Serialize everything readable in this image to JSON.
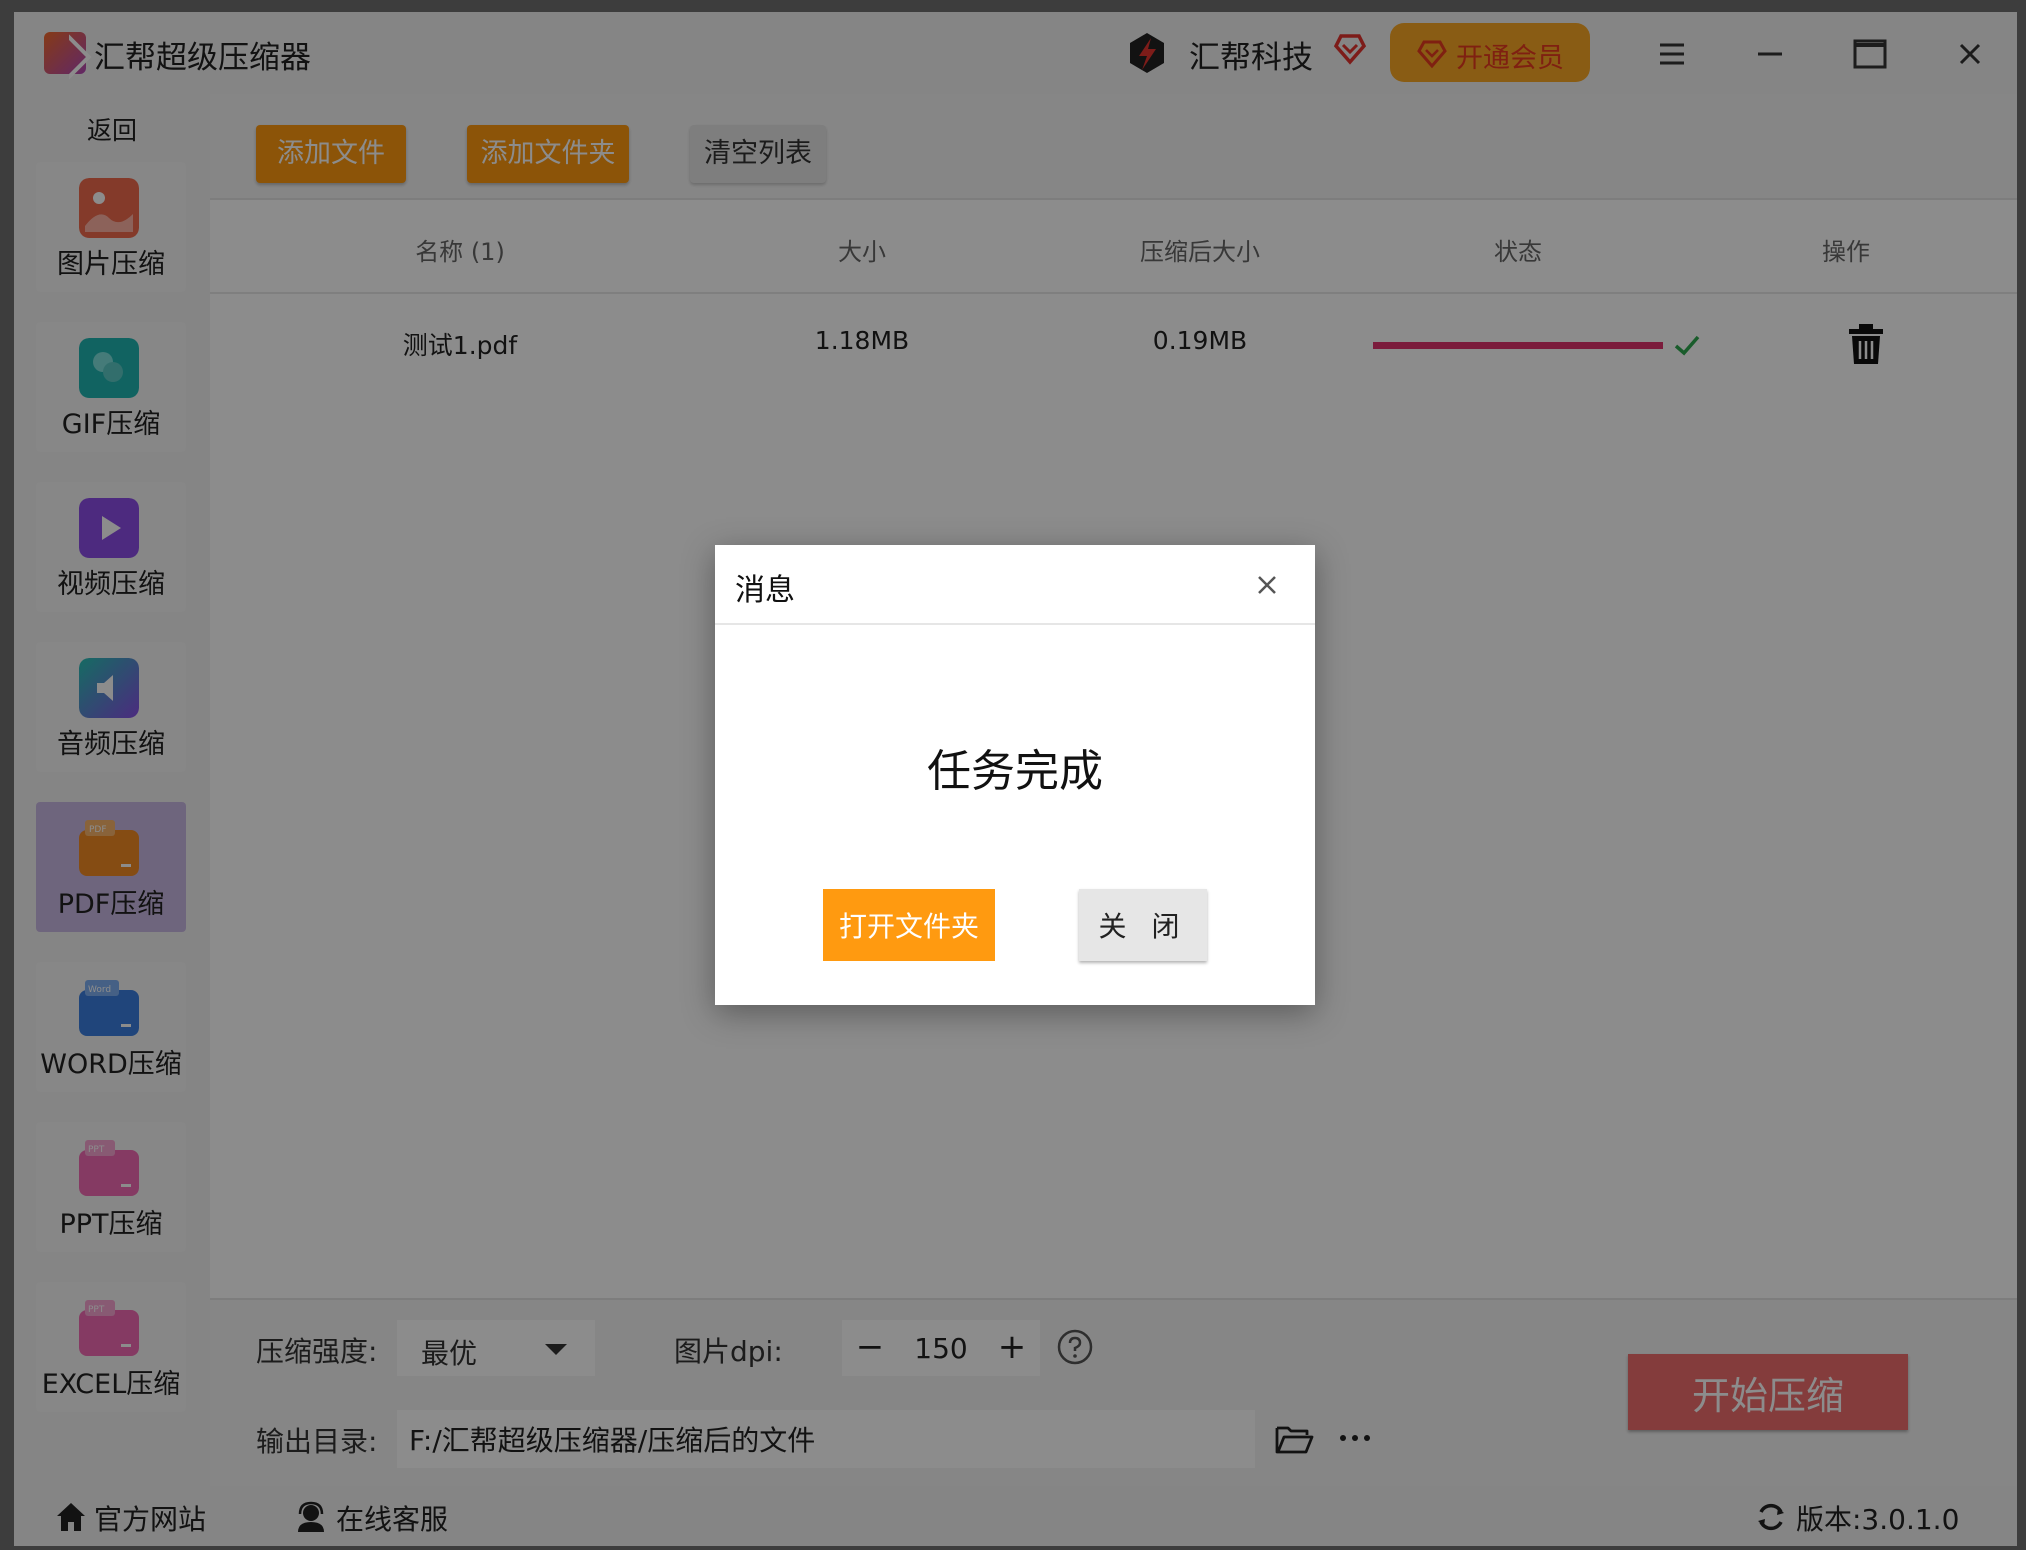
{
  "app": {
    "title": "汇帮超级压缩器",
    "brand": "汇帮科技",
    "vip_button": "开通会员"
  },
  "sidebar": {
    "back": "返回",
    "items": [
      {
        "label": "图片压缩",
        "icon": "image-icon",
        "color": "#f06a4e"
      },
      {
        "label": "GIF压缩",
        "icon": "gif-icon",
        "color": "#1fb5b1"
      },
      {
        "label": "视频压缩",
        "icon": "video-icon",
        "color": "#8d4ee8"
      },
      {
        "label": "音频压缩",
        "icon": "audio-icon",
        "color": "#6c8ee8"
      },
      {
        "label": "PDF压缩",
        "icon": "pdf-icon",
        "color": "#f28a24",
        "active": true
      },
      {
        "label": "WORD压缩",
        "icon": "word-icon",
        "color": "#3b7ee0"
      },
      {
        "label": "PPT压缩",
        "icon": "ppt-icon",
        "color": "#f26ab4"
      },
      {
        "label": "EXCEL压缩",
        "icon": "excel-icon",
        "color": "#f26ab4"
      }
    ]
  },
  "toolbar": {
    "add_file": "添加文件",
    "add_folder": "添加文件夹",
    "clear_list": "清空列表"
  },
  "table": {
    "headers": [
      "名称 (1)",
      "大小",
      "压缩后大小",
      "状态",
      "操作"
    ],
    "rows": [
      {
        "name": "测试1.pdf",
        "size": "1.18MB",
        "compressed_size": "0.19MB",
        "progress": 1.0,
        "status": "done"
      }
    ]
  },
  "settings": {
    "strength_label": "压缩强度:",
    "strength_value": "最优",
    "dpi_label": "图片dpi:",
    "dpi_value": "150",
    "output_label": "输出目录:",
    "output_path": "F:/汇帮超级压缩器/压缩后的文件",
    "start_button": "开始压缩"
  },
  "statusbar": {
    "website": "官方网站",
    "support": "在线客服",
    "version": "版本:3.0.1.0"
  },
  "dialog": {
    "title": "消息",
    "message": "任务完成",
    "open_folder": "打开文件夹",
    "close": "关 闭"
  },
  "colors": {
    "accent": "#ff9a10",
    "progress": "#e0346e",
    "start": "#f16e6e",
    "active_nav": "#c9b9e4"
  }
}
